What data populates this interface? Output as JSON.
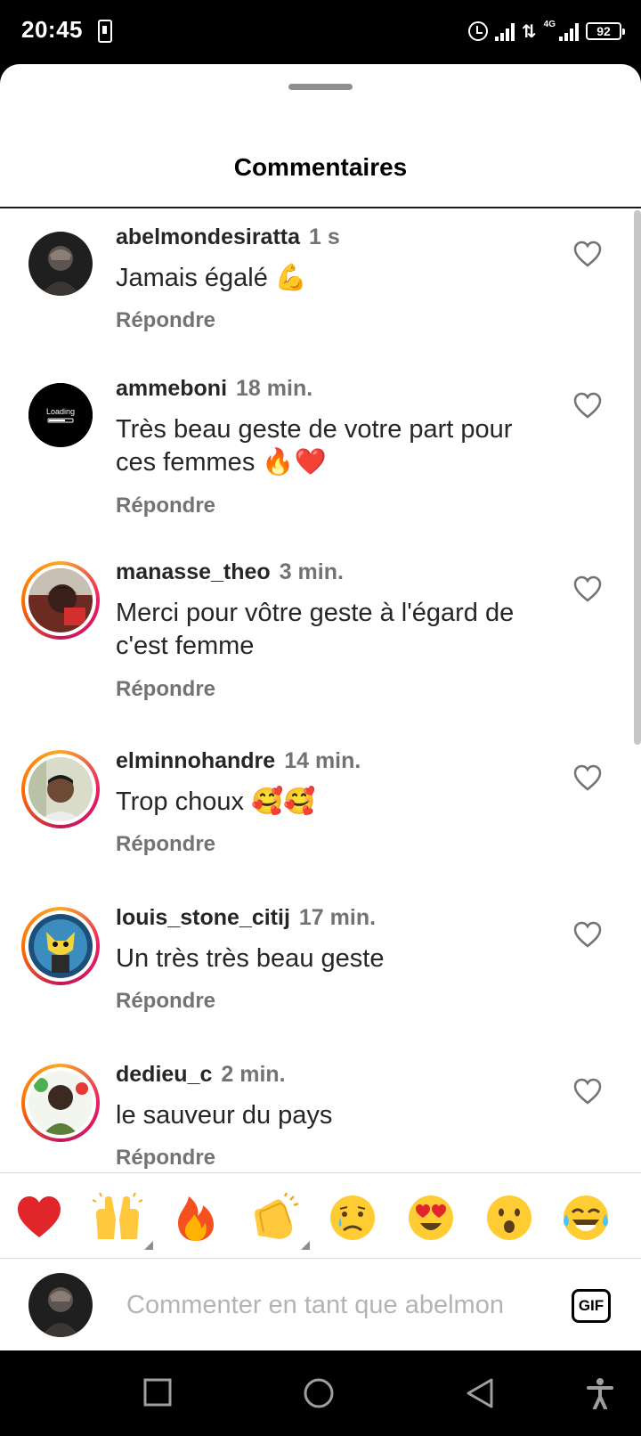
{
  "status_bar": {
    "time": "20:45",
    "network": "4G",
    "battery": "92"
  },
  "sheet": {
    "title": "Commentaires"
  },
  "comments": [
    {
      "username": "abelmondesiratta",
      "time": "1 s",
      "text": "Jamais égalé 💪",
      "reply_label": "Répondre",
      "story_ring": false
    },
    {
      "username": "ammeboni",
      "time": "18 min.",
      "text": "Très beau geste de votre part pour ces femmes 🔥❤️",
      "reply_label": "Répondre",
      "story_ring": false,
      "avatar_label": "Loading"
    },
    {
      "username": "manasse_theo",
      "time": "3 min.",
      "text": "Merci pour vôtre geste à l'égard de c'est femme",
      "reply_label": "Répondre",
      "story_ring": true
    },
    {
      "username": "elminnohandre",
      "time": "14 min.",
      "text": "Trop choux 🥰🥰",
      "reply_label": "Répondre",
      "story_ring": true
    },
    {
      "username": "louis_stone_citij",
      "time": "17 min.",
      "text": "Un très très beau geste",
      "reply_label": "Répondre",
      "story_ring": true
    },
    {
      "username": "dedieu_c",
      "time": "2 min.",
      "text": "le sauveur du pays",
      "reply_label": "Répondre",
      "story_ring": true
    }
  ],
  "quick_reactions": [
    "red-heart",
    "raising-hands",
    "fire",
    "clapping-hands",
    "crying-face",
    "heart-eyes-face",
    "surprised-face",
    "tears-of-joy-face"
  ],
  "composer": {
    "placeholder": "Commenter en tant que abelmon",
    "gif_label": "GIF"
  },
  "colors": {
    "accent_ring_start": "#f9a825",
    "accent_ring_end": "#c2185b",
    "muted_text": "#737373",
    "heart_red": "#e0252b"
  }
}
